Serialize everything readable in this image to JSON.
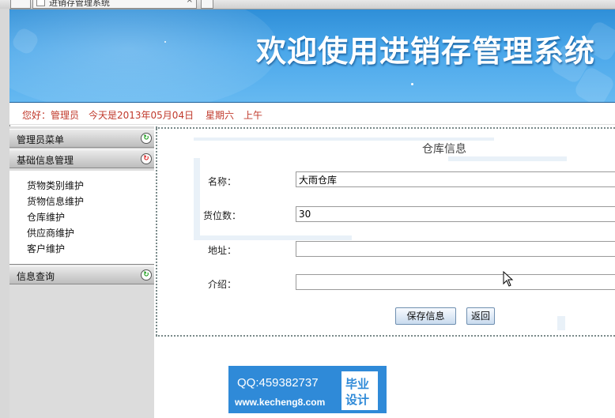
{
  "browser": {
    "tab_title": "进销存管理系统",
    "tab_close": "×"
  },
  "header": {
    "title": "欢迎使用进销存管理系统"
  },
  "status": {
    "greeting": "您好：管理员",
    "date": "今天是2013年05月04日",
    "weekday": "星期六",
    "period": "上午"
  },
  "sidebar": {
    "sections": [
      {
        "label": "管理员菜单",
        "toggle": "↻",
        "state": "collapsed"
      },
      {
        "label": "基础信息管理",
        "toggle": "↻",
        "state": "expanded"
      },
      {
        "label": "信息查询",
        "toggle": "↻",
        "state": "collapsed"
      }
    ],
    "items": [
      {
        "label": "货物类别维护"
      },
      {
        "label": "货物信息维护"
      },
      {
        "label": "仓库维护"
      },
      {
        "label": "供应商维护"
      },
      {
        "label": "客户维护"
      }
    ]
  },
  "form": {
    "title": "仓库信息",
    "fields": [
      {
        "label": "名称：",
        "value": "大雨仓库"
      },
      {
        "label": "货位数：",
        "value": "30"
      },
      {
        "label": "地址：",
        "value": ""
      },
      {
        "label": "介绍：",
        "value": ""
      }
    ],
    "save_label": "保存信息",
    "back_label": "返回"
  },
  "promo": {
    "qq": "QQ:459382737",
    "site": "www.kecheng8.com",
    "badge_line1": "毕业",
    "badge_line2": "设计"
  },
  "colors": {
    "banner": "#4aa7ea",
    "status_text": "#c0392b",
    "promo": "#2f8ad8"
  }
}
